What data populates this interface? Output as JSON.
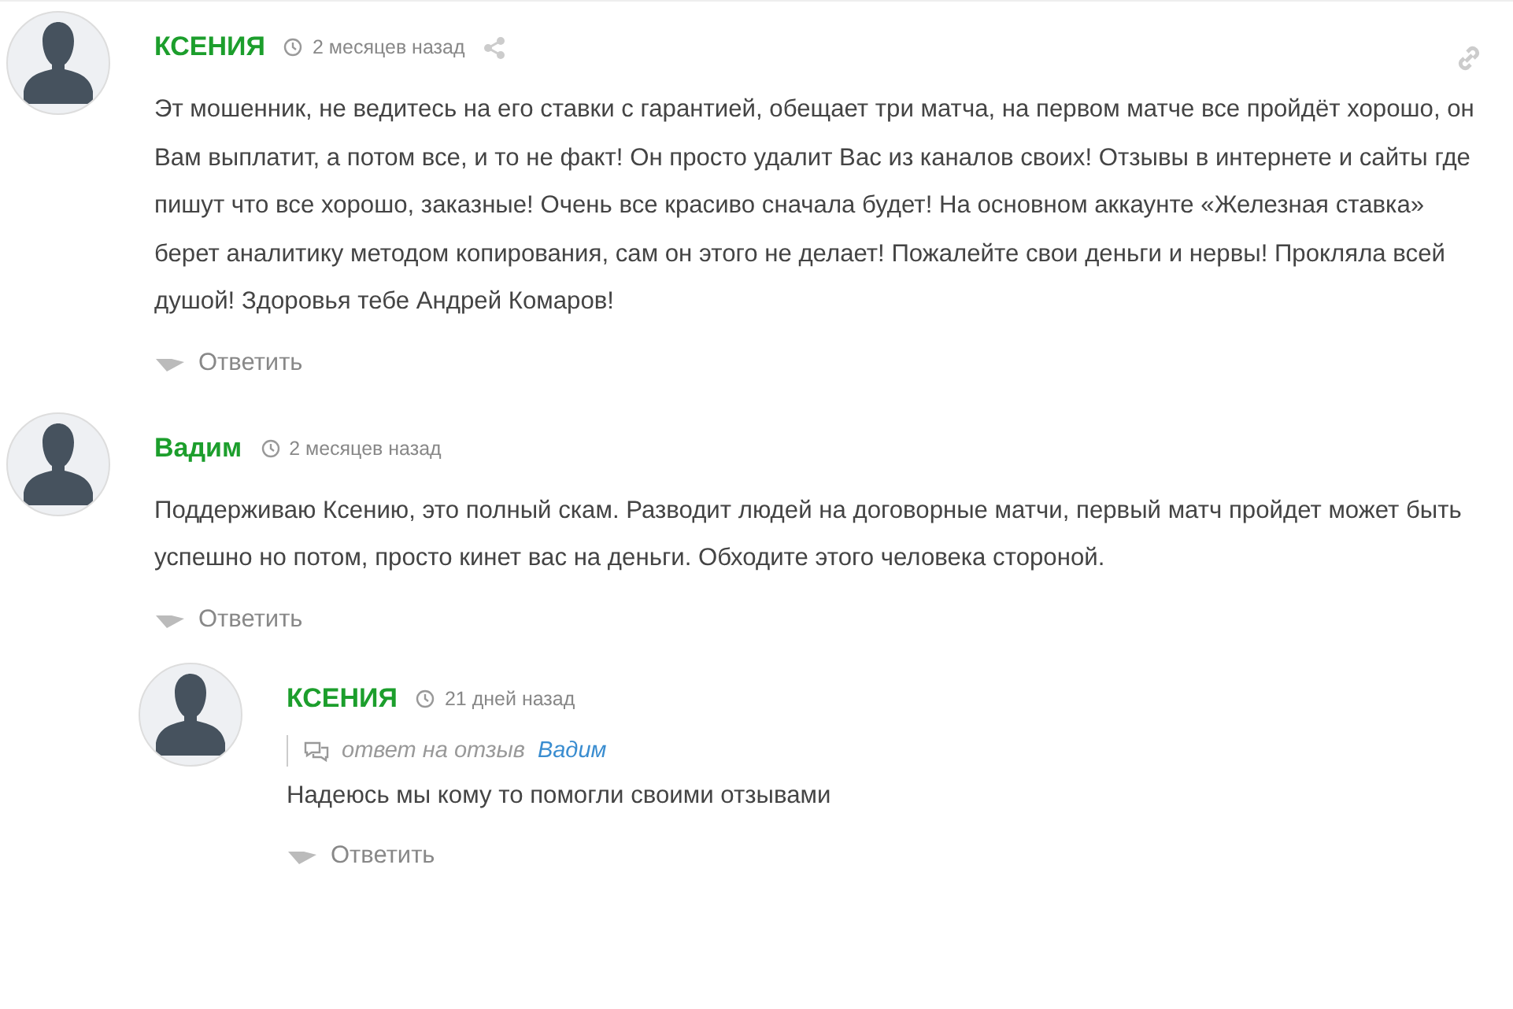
{
  "comments": [
    {
      "author": "КСЕНИЯ",
      "time": "2 месяцев назад",
      "share": true,
      "permalink": true,
      "text": "Эт мошенник, не ведитесь на его ставки с гарантией, обещает три матча, на первом матче все пройдёт хорошо, он Вам выплатит, а потом все, и то не факт! Он просто удалит Вас из каналов своих! Отзывы в интернете и сайты где пишут что все хорошо, заказные! Очень все красиво сначала будет! На основном аккаунте «Железная ставка» берет аналитику методом копирования, сам он этого не делает! Пожалейте свои деньги и нервы! Прокляла всей душой! Здоровья тебе Андрей Комаров!",
      "reply": "Ответить"
    },
    {
      "author": "Вадим",
      "time": "2 месяцев назад",
      "share": false,
      "permalink": false,
      "text": "Поддерживаю Ксению, это полный скам. Разводит людей на договорные матчи, первый матч пройдет может быть успешно но потом, просто кинет вас на деньги. Обходите этого человека стороной.",
      "reply": "Ответить",
      "children": [
        {
          "author": "КСЕНИЯ",
          "time": "21 дней назад",
          "share": false,
          "permalink": false,
          "reply_to": {
            "label": "ответ на отзыв",
            "name": "Вадим"
          },
          "text": "Надеюсь мы кому то помогли своими отзывами",
          "reply": "Ответить"
        }
      ]
    }
  ]
}
